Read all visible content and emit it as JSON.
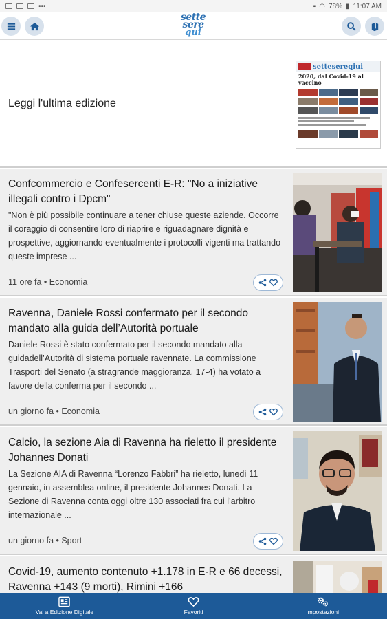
{
  "status_bar": {
    "battery": "78%",
    "time": "11:07 AM"
  },
  "header": {
    "logo_line1": "sette",
    "logo_line2": "sere",
    "logo_line3": "qui",
    "menu_icon": "hamburger-icon",
    "home_icon": "home-icon",
    "search_icon": "search-icon",
    "edition_icon": "newspaper-icon"
  },
  "edition": {
    "label": "Leggi l'ultima edizione",
    "cover_masthead": "settesereqiui",
    "cover_headline": "2020, dal Covid-19 al vaccino"
  },
  "articles": [
    {
      "title": "Confcommercio e Confesercenti E-R: \"No a iniziative illegali contro i Dpcm\"",
      "excerpt": "\"Non è più possibile continuare a tener chiuse queste aziende. Occorre il coraggio di consentire loro di riaprire e riguadagnare dignità e prospettive, aggiornando eventualmente i protocolli vigenti ma trattando queste imprese ...",
      "meta": "11 ore fa • Economia"
    },
    {
      "title": "Ravenna, Daniele Rossi confermato per il secondo mandato alla guida dell’Autorità portuale",
      "excerpt": "Daniele Rossi è stato confermato per il secondo mandato alla guidadell’Autorità di sistema portuale ravennate. La commissione Trasporti del Senato (a stragrande maggioranza, 17-4) ha votato a favore della conferma per il secondo ...",
      "meta": "un giorno fa • Economia"
    },
    {
      "title": "Calcio, la sezione Aia di Ravenna ha rieletto il presidente Johannes Donati",
      "excerpt": "La Sezione AIA di Ravenna “Lorenzo Fabbri” ha rieletto, lunedì 11 gennaio, in assemblea online, il presidente Johannes Donati.  La Sezione di Ravenna conta oggi oltre 130 associati fra cui l’arbitro internazionale ...",
      "meta": "un giorno fa • Sport"
    },
    {
      "title": "Covid-19, aumento contenuto +1.178 in E-R e 66 decessi, Ravenna +143 (9 morti), Rimini +166",
      "excerpt": "",
      "meta": ""
    }
  ],
  "bottom_nav": [
    {
      "label": "Vai a Edizione Digitale",
      "icon": "digital-edition-icon"
    },
    {
      "label": "Favoriti",
      "icon": "heart-icon"
    },
    {
      "label": "Impostazioni",
      "icon": "gear-icon"
    }
  ],
  "colors": {
    "brand_blue": "#1d5a98",
    "logo_blue": "#2d71b3",
    "card_bg": "#efefef"
  }
}
